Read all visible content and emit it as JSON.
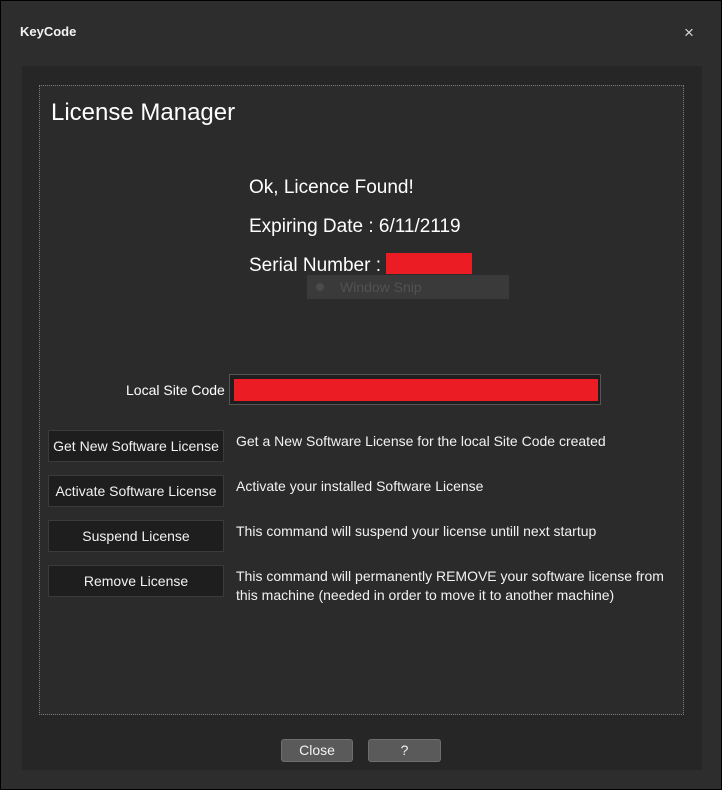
{
  "window": {
    "title": "KeyCode",
    "close_glyph": "×"
  },
  "main": {
    "heading": "License Manager"
  },
  "status": {
    "found": "Ok, Licence Found!",
    "expiring": "Expiring Date : 6/11/2119",
    "serial_label": "Serial Number :",
    "redaction_color": "#ec1c24"
  },
  "overlay": {
    "label": "Window Snip"
  },
  "site_code": {
    "label": "Local Site Code"
  },
  "commands": [
    {
      "button": "Get New Software License",
      "description": "Get a New Software License for the local Site Code created"
    },
    {
      "button": "Activate Software License",
      "description": "Activate your installed Software License"
    },
    {
      "button": "Suspend License",
      "description": "This command will suspend your license untill next startup"
    },
    {
      "button": "Remove License",
      "description": "This command will permanently REMOVE your software license from this machine (needed in order to move it to another machine)"
    }
  ],
  "footer": {
    "close_label": "Close",
    "help_label": "?"
  }
}
